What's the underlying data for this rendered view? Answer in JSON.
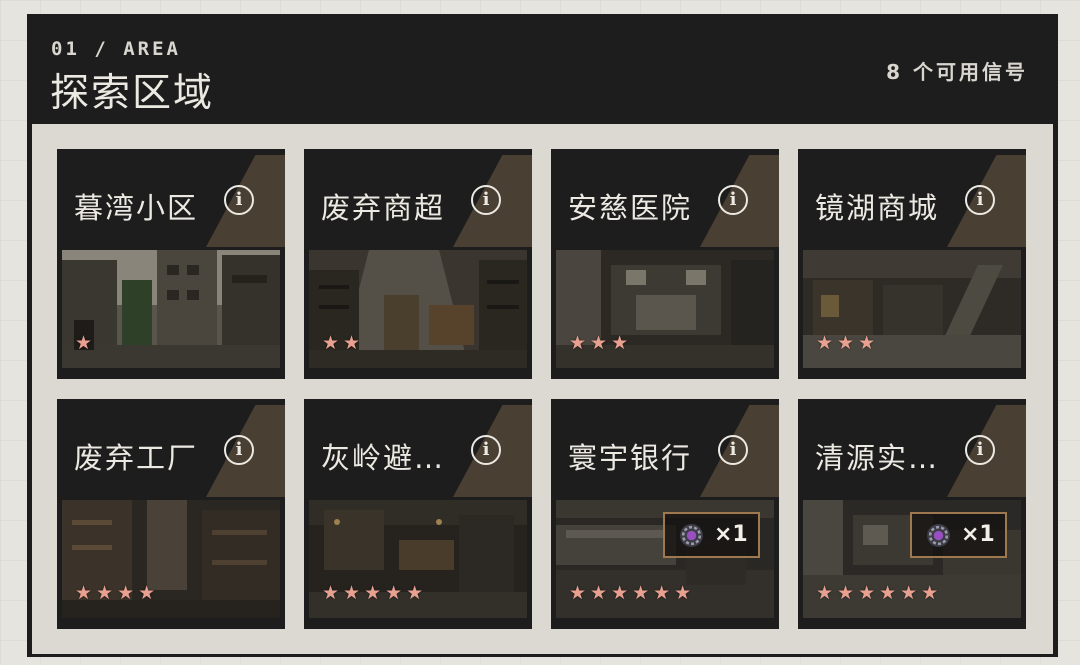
{
  "header": {
    "subtitle": "01 / AREA",
    "title": "探索区域",
    "signal_text": "8 个可用信号"
  },
  "colors": {
    "panel": "#1d1d1d",
    "content_bg": "#dcd9d2",
    "accent": "#4a3f33",
    "star": "#e8a091",
    "reward_border": "#a07850"
  },
  "areas": [
    {
      "name": "暮湾小区",
      "stars": "★",
      "star_count": 1,
      "reward": ""
    },
    {
      "name": "废弃商超",
      "stars": "★★",
      "star_count": 2,
      "reward": ""
    },
    {
      "name": "安慈医院",
      "stars": "★★★",
      "star_count": 3,
      "reward": ""
    },
    {
      "name": "镜湖商城",
      "stars": "★★★",
      "star_count": 3,
      "reward": ""
    },
    {
      "name": "废弃工厂",
      "stars": "★★★★",
      "star_count": 4,
      "reward": ""
    },
    {
      "name": "灰岭避…",
      "stars": "★★★★★",
      "star_count": 5,
      "reward": ""
    },
    {
      "name": "寰宇银行",
      "stars": "★★★★★★",
      "star_count": 6,
      "reward": "×1",
      "reward_icon": "gear-chip-icon"
    },
    {
      "name": "清源实…",
      "stars": "★★★★★★",
      "star_count": 6,
      "reward": "×1",
      "reward_icon": "gear-chip-icon"
    }
  ]
}
